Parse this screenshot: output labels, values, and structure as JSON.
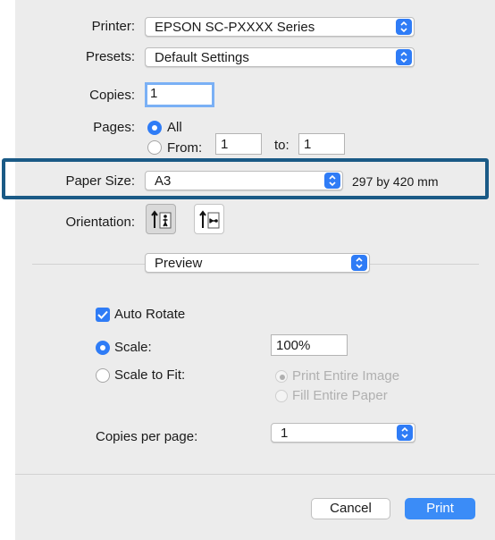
{
  "printer": {
    "label": "Printer:",
    "value": "EPSON SC-PXXXX Series"
  },
  "presets": {
    "label": "Presets:",
    "value": "Default Settings"
  },
  "copies": {
    "label": "Copies:",
    "value": "1"
  },
  "pages": {
    "label": "Pages:",
    "all_label": "All",
    "from_label": "From:",
    "from_value": "1",
    "to_label": "to:",
    "to_value": "1"
  },
  "paper_size": {
    "label": "Paper Size:",
    "value": "A3",
    "dimensions": "297 by 420 mm"
  },
  "orientation": {
    "label": "Orientation:",
    "selected": "portrait"
  },
  "section": {
    "value": "Preview"
  },
  "auto_rotate": {
    "label": "Auto Rotate",
    "checked": true
  },
  "scale": {
    "label": "Scale:",
    "value": "100%",
    "selected": true
  },
  "scale_to_fit": {
    "label": "Scale to Fit:",
    "print_entire_image": "Print Entire Image",
    "fill_entire_paper": "Fill Entire Paper"
  },
  "copies_per_page": {
    "label": "Copies per page:",
    "value": "1"
  },
  "buttons": {
    "cancel": "Cancel",
    "print": "Print"
  },
  "colors": {
    "accent": "#2f7cf6",
    "highlight_border": "#1a5a86",
    "dialog_bg": "#ececec"
  },
  "icons": {
    "popup_chevron": "up-down-chevron-icon",
    "portrait": "portrait-orientation-icon",
    "landscape": "landscape-orientation-icon",
    "check": "checkmark-icon"
  }
}
